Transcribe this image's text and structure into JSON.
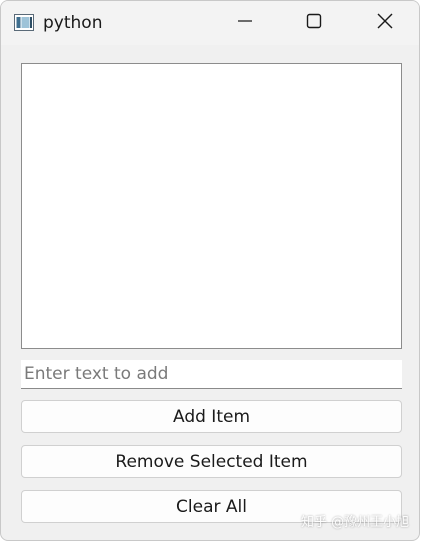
{
  "window": {
    "title": "python",
    "app_icon": "python-window-icon",
    "controls": {
      "minimize_icon": "minimize-icon",
      "maximize_icon": "maximize-icon",
      "close_icon": "close-icon"
    }
  },
  "list": {
    "items": []
  },
  "input": {
    "value": "",
    "placeholder": "Enter text to add"
  },
  "buttons": {
    "add_label": "Add Item",
    "remove_label": "Remove Selected Item",
    "clear_label": "Clear All"
  },
  "watermark": {
    "text": "知乎 @豫州王小旭"
  },
  "colors": {
    "window_background": "#f0f0f0",
    "titlebar_background": "#f3f3f3",
    "list_background": "#ffffff",
    "button_background": "#fdfdfd",
    "text": "#1a1a1a",
    "placeholder": "#7a7a7a"
  }
}
